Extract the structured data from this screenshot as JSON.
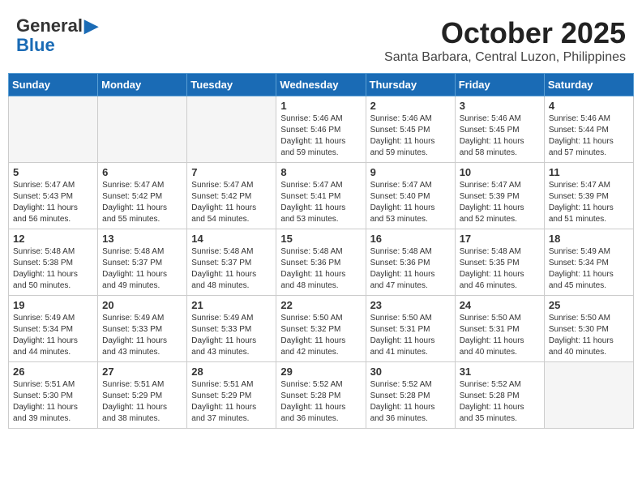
{
  "header": {
    "logo_line1": "General",
    "logo_line2": "Blue",
    "month": "October 2025",
    "location": "Santa Barbara, Central Luzon, Philippines"
  },
  "weekdays": [
    "Sunday",
    "Monday",
    "Tuesday",
    "Wednesday",
    "Thursday",
    "Friday",
    "Saturday"
  ],
  "weeks": [
    [
      {
        "day": "",
        "info": ""
      },
      {
        "day": "",
        "info": ""
      },
      {
        "day": "",
        "info": ""
      },
      {
        "day": "1",
        "info": "Sunrise: 5:46 AM\nSunset: 5:46 PM\nDaylight: 11 hours\nand 59 minutes."
      },
      {
        "day": "2",
        "info": "Sunrise: 5:46 AM\nSunset: 5:45 PM\nDaylight: 11 hours\nand 59 minutes."
      },
      {
        "day": "3",
        "info": "Sunrise: 5:46 AM\nSunset: 5:45 PM\nDaylight: 11 hours\nand 58 minutes."
      },
      {
        "day": "4",
        "info": "Sunrise: 5:46 AM\nSunset: 5:44 PM\nDaylight: 11 hours\nand 57 minutes."
      }
    ],
    [
      {
        "day": "5",
        "info": "Sunrise: 5:47 AM\nSunset: 5:43 PM\nDaylight: 11 hours\nand 56 minutes."
      },
      {
        "day": "6",
        "info": "Sunrise: 5:47 AM\nSunset: 5:42 PM\nDaylight: 11 hours\nand 55 minutes."
      },
      {
        "day": "7",
        "info": "Sunrise: 5:47 AM\nSunset: 5:42 PM\nDaylight: 11 hours\nand 54 minutes."
      },
      {
        "day": "8",
        "info": "Sunrise: 5:47 AM\nSunset: 5:41 PM\nDaylight: 11 hours\nand 53 minutes."
      },
      {
        "day": "9",
        "info": "Sunrise: 5:47 AM\nSunset: 5:40 PM\nDaylight: 11 hours\nand 53 minutes."
      },
      {
        "day": "10",
        "info": "Sunrise: 5:47 AM\nSunset: 5:39 PM\nDaylight: 11 hours\nand 52 minutes."
      },
      {
        "day": "11",
        "info": "Sunrise: 5:47 AM\nSunset: 5:39 PM\nDaylight: 11 hours\nand 51 minutes."
      }
    ],
    [
      {
        "day": "12",
        "info": "Sunrise: 5:48 AM\nSunset: 5:38 PM\nDaylight: 11 hours\nand 50 minutes."
      },
      {
        "day": "13",
        "info": "Sunrise: 5:48 AM\nSunset: 5:37 PM\nDaylight: 11 hours\nand 49 minutes."
      },
      {
        "day": "14",
        "info": "Sunrise: 5:48 AM\nSunset: 5:37 PM\nDaylight: 11 hours\nand 48 minutes."
      },
      {
        "day": "15",
        "info": "Sunrise: 5:48 AM\nSunset: 5:36 PM\nDaylight: 11 hours\nand 48 minutes."
      },
      {
        "day": "16",
        "info": "Sunrise: 5:48 AM\nSunset: 5:36 PM\nDaylight: 11 hours\nand 47 minutes."
      },
      {
        "day": "17",
        "info": "Sunrise: 5:48 AM\nSunset: 5:35 PM\nDaylight: 11 hours\nand 46 minutes."
      },
      {
        "day": "18",
        "info": "Sunrise: 5:49 AM\nSunset: 5:34 PM\nDaylight: 11 hours\nand 45 minutes."
      }
    ],
    [
      {
        "day": "19",
        "info": "Sunrise: 5:49 AM\nSunset: 5:34 PM\nDaylight: 11 hours\nand 44 minutes."
      },
      {
        "day": "20",
        "info": "Sunrise: 5:49 AM\nSunset: 5:33 PM\nDaylight: 11 hours\nand 43 minutes."
      },
      {
        "day": "21",
        "info": "Sunrise: 5:49 AM\nSunset: 5:33 PM\nDaylight: 11 hours\nand 43 minutes."
      },
      {
        "day": "22",
        "info": "Sunrise: 5:50 AM\nSunset: 5:32 PM\nDaylight: 11 hours\nand 42 minutes."
      },
      {
        "day": "23",
        "info": "Sunrise: 5:50 AM\nSunset: 5:31 PM\nDaylight: 11 hours\nand 41 minutes."
      },
      {
        "day": "24",
        "info": "Sunrise: 5:50 AM\nSunset: 5:31 PM\nDaylight: 11 hours\nand 40 minutes."
      },
      {
        "day": "25",
        "info": "Sunrise: 5:50 AM\nSunset: 5:30 PM\nDaylight: 11 hours\nand 40 minutes."
      }
    ],
    [
      {
        "day": "26",
        "info": "Sunrise: 5:51 AM\nSunset: 5:30 PM\nDaylight: 11 hours\nand 39 minutes."
      },
      {
        "day": "27",
        "info": "Sunrise: 5:51 AM\nSunset: 5:29 PM\nDaylight: 11 hours\nand 38 minutes."
      },
      {
        "day": "28",
        "info": "Sunrise: 5:51 AM\nSunset: 5:29 PM\nDaylight: 11 hours\nand 37 minutes."
      },
      {
        "day": "29",
        "info": "Sunrise: 5:52 AM\nSunset: 5:28 PM\nDaylight: 11 hours\nand 36 minutes."
      },
      {
        "day": "30",
        "info": "Sunrise: 5:52 AM\nSunset: 5:28 PM\nDaylight: 11 hours\nand 36 minutes."
      },
      {
        "day": "31",
        "info": "Sunrise: 5:52 AM\nSunset: 5:28 PM\nDaylight: 11 hours\nand 35 minutes."
      },
      {
        "day": "",
        "info": ""
      }
    ]
  ]
}
